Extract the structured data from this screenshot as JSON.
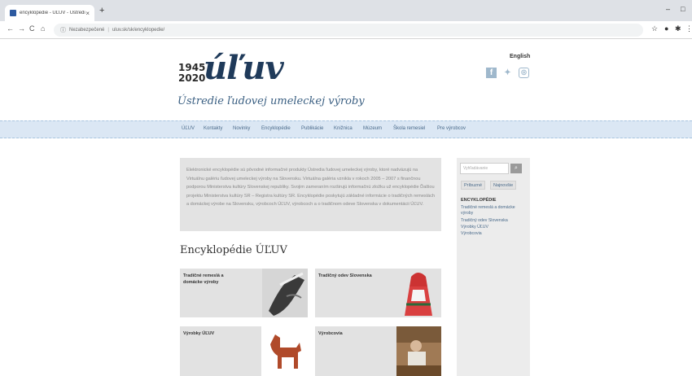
{
  "browser": {
    "tab_title": "encyklopedie - ÚĽUV - Ústredi...",
    "tab_close": "×",
    "new_tab": "+",
    "win_minimize": "–",
    "win_maximize": "□",
    "nav_back": "←",
    "nav_forward": "→",
    "nav_reload": "C",
    "nav_home": "⌂",
    "security_label": "Nezabezpečené",
    "url": "uluv.sk/sk/encyklopedie/"
  },
  "site": {
    "logo_years": [
      "1945",
      "2020"
    ],
    "logo_word": "úľuv",
    "logo_subtitle": "Ústredie ľudovej umeleckej výroby",
    "language_link": "English"
  },
  "menu": [
    "ÚĽUV",
    "Kontakty",
    "Novinky",
    "Encyklopédie",
    "Publikácie",
    "Knižnica",
    "Múzeum",
    "Škola remesiel",
    "Pre výrobcov"
  ],
  "intro_text": "Elektronické encyklopédie sú pôvodné informačné produkty Ústredia ľudovej umeleckej výroby, ktoré nadväzujú na Virtuálnu galériu ľudovej umeleckej výroby na Slovensku. Virtuálna galéria vznikla v rokoch 2005 – 2007 s finančnou podporou Ministerstva kultúry Slovenskej republiky. Svojim zameraním rozširujú informačnú zložku už encyklopédie Ďalšou projektu Ministerstva kultúry SR – Registra kultúry SR. Encyklopédie poskytujú základné informácie o tradičných remeslách a domáckej výrobe na Slovensku, výrobcoch ÚĽUV, výrobcoch a o tradičnom odeve Slovenska v dokumentácii ÚĽUV.",
  "section_heading": "Encyklopédie ÚĽUV",
  "cards": [
    {
      "label": "Tradičné remeslá a domácke výroby"
    },
    {
      "label": "Tradičný odev Slovenska"
    },
    {
      "label": "Výrobky ÚĽUV"
    },
    {
      "label": "Výrobcovia"
    }
  ],
  "sidebar": {
    "search_placeholder": "Vyhľadávanie",
    "tabs": [
      "Príbuzné",
      "Najnovšie"
    ],
    "heading": "ENCYKLOPÉDIE",
    "links": [
      "Tradičné remeslá a domácke výroby",
      "Tradičný odev Slovenska",
      "Výrobky ÚĽUV",
      "Výrobcovia"
    ]
  },
  "colors": {
    "menu_band": "#dbe7f4",
    "logo": "#1f3a5a",
    "link": "#4a6a8a",
    "social": "#9fb8cc"
  },
  "icons": {
    "facebook": "facebook-icon",
    "twitter": "twitter-icon",
    "instagram": "instagram-icon"
  }
}
